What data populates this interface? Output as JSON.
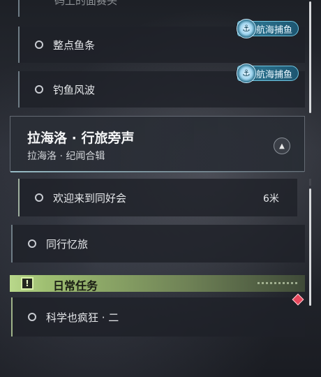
{
  "quests_top": {
    "faded_partial": "码上的面赛头",
    "items": [
      {
        "label": "整点鱼条",
        "tag": "航海捕鱼"
      },
      {
        "label": "钓鱼风波",
        "tag": "航海捕鱼"
      }
    ]
  },
  "section": {
    "title": "拉海洛 · 行旅旁声",
    "subtitle": "拉海洛 · 纪闻合辑",
    "collapse_icon": "chevron-up-icon",
    "items": [
      {
        "label": "欢迎来到同好会",
        "distance": "6米"
      },
      {
        "label": "同行忆旅"
      }
    ]
  },
  "daily": {
    "title": "日常任务",
    "badge_icon": "exclamation-icon",
    "items": [
      {
        "label": "科学也疯狂 · 二"
      }
    ]
  },
  "colors": {
    "tag_blue": "#2a6f8a",
    "daily_green": "#b9d88b",
    "marker_red": "#e8475c"
  }
}
